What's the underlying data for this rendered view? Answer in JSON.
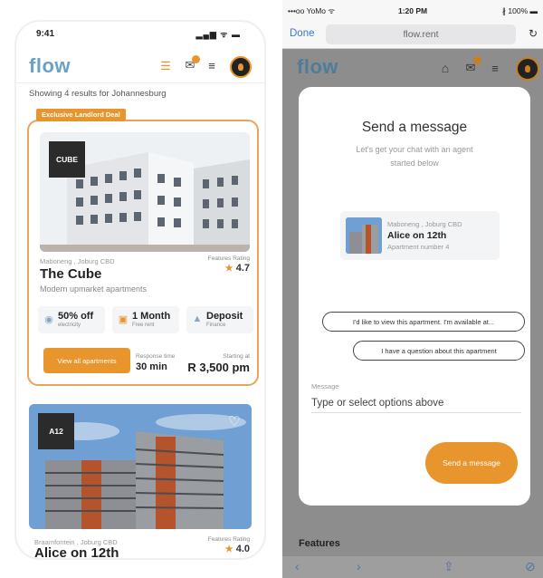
{
  "left": {
    "status_time": "9:41",
    "status_icons": "▂▄▆ ᯤ ▬",
    "logo": "flow",
    "results_text": "Showing 4 results for Johannesburg",
    "deal_tag": "Exclusive Landlord Deal",
    "listing1": {
      "code": "CUBE",
      "location": "Maboneng , Joburg CBD",
      "rating_label": "Features Rating",
      "rating": "4.7",
      "name": "The Cube",
      "description": "Modern upmarket apartments",
      "features": [
        {
          "icon": "lightbulb-icon",
          "glyph": "💡",
          "value": "50% off",
          "sub": "electricity"
        },
        {
          "icon": "gift-icon",
          "glyph": "🎁",
          "value": "1 Month",
          "sub": "Free rent"
        },
        {
          "icon": "thumbs-up-icon",
          "glyph": "👍",
          "value": "Deposit",
          "sub": "Finance"
        }
      ],
      "button": "View all apartments",
      "response_label": "Response time",
      "response_value": "30 min",
      "starting_label": "Starting at",
      "starting_value": "R 3,500 pm"
    },
    "listing2": {
      "code": "A12",
      "location": "Braamfontein , Joburg CBD",
      "rating_label": "Features Rating",
      "rating": "4.0",
      "name": "Alice on 12th"
    }
  },
  "right": {
    "carrier": "•••oo YoMo ᯤ",
    "time": "1:20 PM",
    "battery": "∦ 100% ▬",
    "done": "Done",
    "url": "flow.rent",
    "logo": "flow",
    "modal": {
      "title": "Send a message",
      "subtitle": "Let's get your chat with an agent started below",
      "apt_location": "Maboneng , Joburg CBD",
      "apt_name": "Alice on 12th",
      "apt_number": "Apartment number 4",
      "option1": "I'd like to view this apartment. I'm available at...",
      "option2": "I have a question about this apartment",
      "message_label": "Message",
      "message_placeholder": "Type or select options above",
      "send_button": "Send a message"
    },
    "features_label": "Features"
  },
  "colors": {
    "accent": "#e7952c",
    "logo_blue": "#6aa2c6",
    "ios_link": "#3478d6"
  }
}
